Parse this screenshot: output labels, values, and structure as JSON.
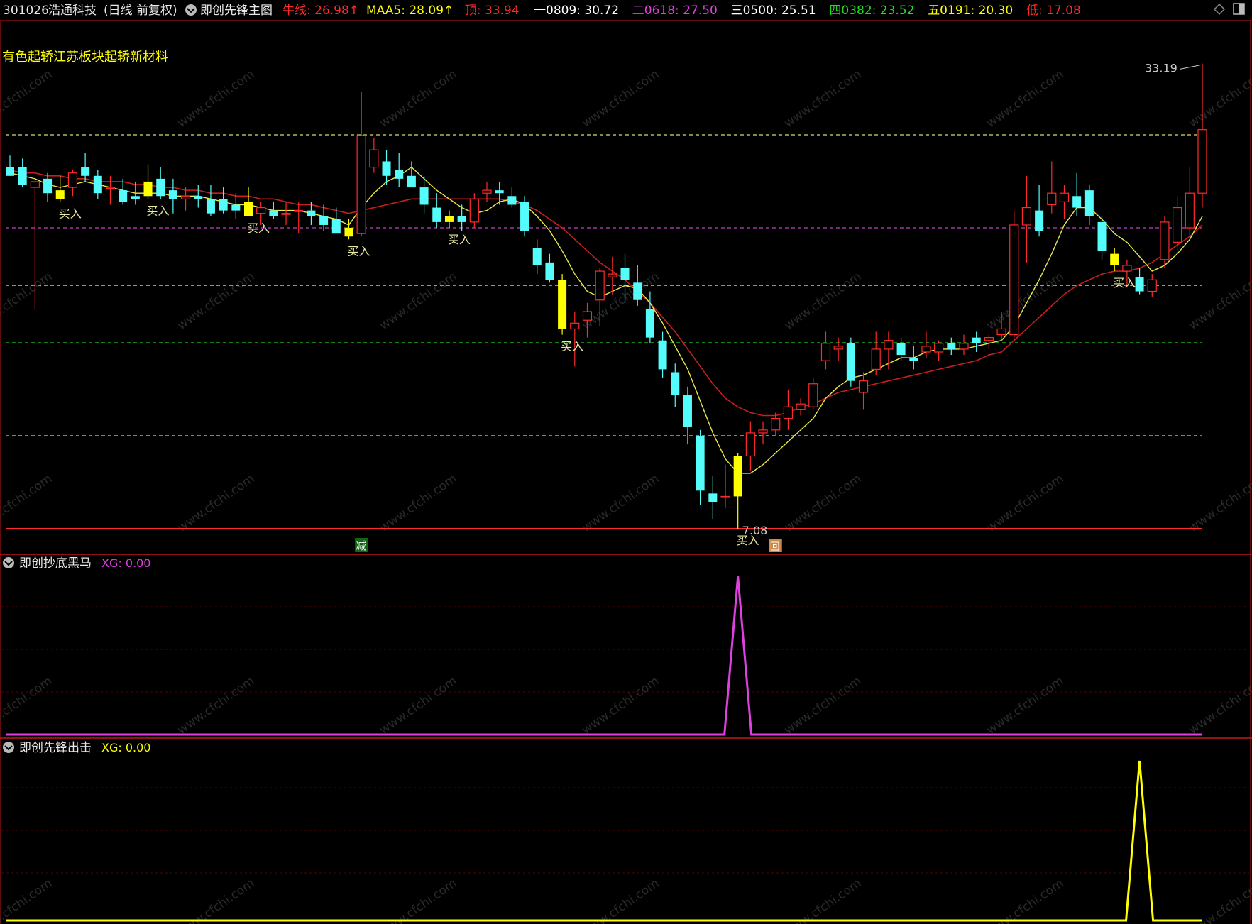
{
  "colors": {
    "red": "#ff2a2a",
    "darkred": "#c01818",
    "cyan": "#54fcfc",
    "yellow": "#ffff00",
    "ma_yellow": "#e8e84a",
    "ma_red": "#c81e1e",
    "magenta": "#e040e0",
    "green": "#22dd22",
    "white": "#e8e8e8",
    "grid": "#5a0000"
  },
  "header": {
    "code": "301026",
    "name": "浩通科技",
    "period": "(日线 前复权)",
    "indicator": "即创先锋主图",
    "items": [
      {
        "label": "牛线:",
        "value": "26.98",
        "arrow": "↑",
        "color": "#ff2a2a"
      },
      {
        "label": "MAA5:",
        "value": "28.09",
        "arrow": "↑",
        "color": "#ffff00"
      },
      {
        "label": "顶:",
        "value": "33.94",
        "arrow": "",
        "color": "#ff2a2a"
      },
      {
        "label": "一0809:",
        "value": "30.72",
        "arrow": "",
        "color": "#ffffff"
      },
      {
        "label": "二0618:",
        "value": "27.50",
        "arrow": "",
        "color": "#e040e0"
      },
      {
        "label": "三0500:",
        "value": "25.51",
        "arrow": "",
        "color": "#ffffff"
      },
      {
        "label": "四0382:",
        "value": "23.52",
        "arrow": "",
        "color": "#22dd22"
      },
      {
        "label": "五0191:",
        "value": "20.30",
        "arrow": "",
        "color": "#ffff00"
      },
      {
        "label": "低:",
        "value": "17.08",
        "arrow": "",
        "color": "#ff2a2a"
      }
    ]
  },
  "sector_text": "有色起轿江苏板块起轿新材料",
  "annotations": {
    "high_label": "33.19",
    "low_label": "7.08",
    "buy_label": "买入",
    "reduce_label": "减",
    "hui_label": "回"
  },
  "panels": [
    {
      "title": "即创抄底黑马",
      "xg_label": "XG: 0.00",
      "xg_color": "#e040e0"
    },
    {
      "title": "即创先锋出击",
      "xg_label": "XG: 0.00",
      "xg_color": "#ffff00"
    }
  ],
  "watermark": "www.cfchi.com",
  "icons": [
    "dropdown-circle-icon",
    "diamond-icon",
    "window-toggle-icon"
  ],
  "chart_data": [
    {
      "type": "candlestick",
      "title": "即创先锋主图",
      "price_levels": [
        {
          "name": "顶",
          "value": 33.94
        },
        {
          "name": "一0809",
          "value": 30.72
        },
        {
          "name": "二0618",
          "value": 27.5
        },
        {
          "name": "三0500",
          "value": 25.51
        },
        {
          "name": "四0382",
          "value": 23.52
        },
        {
          "name": "五0191",
          "value": 20.3
        },
        {
          "name": "低",
          "value": 17.08
        }
      ],
      "candles": [
        {
          "o": 29.6,
          "h": 30.0,
          "l": 29.3,
          "c": 29.3
        },
        {
          "o": 29.6,
          "h": 29.9,
          "l": 28.9,
          "c": 29.0
        },
        {
          "o": 28.9,
          "h": 29.1,
          "l": 24.7,
          "c": 29.1
        },
        {
          "o": 29.2,
          "h": 29.4,
          "l": 28.4,
          "c": 28.7
        },
        {
          "o": 28.8,
          "h": 29.3,
          "l": 28.4,
          "c": 28.5
        },
        {
          "o": 28.9,
          "h": 29.5,
          "l": 28.6,
          "c": 29.4
        },
        {
          "o": 29.6,
          "h": 30.1,
          "l": 29.1,
          "c": 29.3
        },
        {
          "o": 29.3,
          "h": 29.5,
          "l": 28.5,
          "c": 28.7
        },
        {
          "o": 28.9,
          "h": 29.3,
          "l": 28.3,
          "c": 28.9
        },
        {
          "o": 28.8,
          "h": 29.2,
          "l": 28.3,
          "c": 28.4
        },
        {
          "o": 28.6,
          "h": 29.1,
          "l": 28.3,
          "c": 28.5
        },
        {
          "o": 29.1,
          "h": 29.7,
          "l": 28.5,
          "c": 28.6
        },
        {
          "o": 29.2,
          "h": 29.6,
          "l": 28.5,
          "c": 28.6
        },
        {
          "o": 28.8,
          "h": 29.2,
          "l": 28.0,
          "c": 28.5
        },
        {
          "o": 28.5,
          "h": 28.9,
          "l": 28.1,
          "c": 28.6
        },
        {
          "o": 28.6,
          "h": 29.0,
          "l": 28.2,
          "c": 28.5
        },
        {
          "o": 28.5,
          "h": 29.0,
          "l": 27.9,
          "c": 28.0
        },
        {
          "o": 28.5,
          "h": 28.9,
          "l": 28.0,
          "c": 28.1
        },
        {
          "o": 28.3,
          "h": 28.7,
          "l": 27.8,
          "c": 28.1
        },
        {
          "o": 28.4,
          "h": 28.9,
          "l": 27.9,
          "c": 27.9
        },
        {
          "o": 28.0,
          "h": 28.4,
          "l": 27.6,
          "c": 28.2
        },
        {
          "o": 28.1,
          "h": 28.4,
          "l": 27.8,
          "c": 27.9
        },
        {
          "o": 28.0,
          "h": 28.4,
          "l": 27.6,
          "c": 28.0
        },
        {
          "o": 28.1,
          "h": 28.4,
          "l": 27.3,
          "c": 28.1
        },
        {
          "o": 28.1,
          "h": 28.4,
          "l": 27.6,
          "c": 27.9
        },
        {
          "o": 27.9,
          "h": 28.3,
          "l": 27.4,
          "c": 27.6
        },
        {
          "o": 27.8,
          "h": 28.2,
          "l": 27.3,
          "c": 27.3
        },
        {
          "o": 27.5,
          "h": 27.8,
          "l": 27.1,
          "c": 27.2
        },
        {
          "o": 27.3,
          "h": 32.2,
          "l": 27.2,
          "c": 30.7
        },
        {
          "o": 29.6,
          "h": 30.6,
          "l": 29.4,
          "c": 30.2
        },
        {
          "o": 29.8,
          "h": 30.2,
          "l": 29.0,
          "c": 29.3
        },
        {
          "o": 29.5,
          "h": 30.1,
          "l": 28.9,
          "c": 29.2
        },
        {
          "o": 29.3,
          "h": 29.8,
          "l": 28.9,
          "c": 28.9
        },
        {
          "o": 28.9,
          "h": 29.3,
          "l": 28.0,
          "c": 28.3
        },
        {
          "o": 28.2,
          "h": 28.7,
          "l": 27.5,
          "c": 27.7
        },
        {
          "o": 27.7,
          "h": 28.1,
          "l": 27.5,
          "c": 27.9
        },
        {
          "o": 27.9,
          "h": 28.3,
          "l": 27.4,
          "c": 27.7
        },
        {
          "o": 27.7,
          "h": 28.7,
          "l": 27.5,
          "c": 28.5
        },
        {
          "o": 28.7,
          "h": 29.1,
          "l": 28.4,
          "c": 28.8
        },
        {
          "o": 28.8,
          "h": 29.1,
          "l": 28.3,
          "c": 28.7
        },
        {
          "o": 28.6,
          "h": 28.9,
          "l": 28.2,
          "c": 28.3
        },
        {
          "o": 28.4,
          "h": 28.6,
          "l": 27.2,
          "c": 27.4
        },
        {
          "o": 26.8,
          "h": 27.1,
          "l": 25.9,
          "c": 26.2
        },
        {
          "o": 26.3,
          "h": 26.6,
          "l": 25.6,
          "c": 25.7
        },
        {
          "o": 25.7,
          "h": 25.9,
          "l": 23.8,
          "c": 24.0
        },
        {
          "o": 24.0,
          "h": 24.6,
          "l": 22.7,
          "c": 24.2
        },
        {
          "o": 24.3,
          "h": 24.9,
          "l": 23.7,
          "c": 24.6
        },
        {
          "o": 25.0,
          "h": 26.1,
          "l": 24.1,
          "c": 26.0
        },
        {
          "o": 25.8,
          "h": 26.5,
          "l": 25.2,
          "c": 25.9
        },
        {
          "o": 26.1,
          "h": 26.6,
          "l": 24.9,
          "c": 25.7
        },
        {
          "o": 25.6,
          "h": 26.2,
          "l": 24.8,
          "c": 25.0
        },
        {
          "o": 24.7,
          "h": 25.3,
          "l": 23.5,
          "c": 23.7
        },
        {
          "o": 23.6,
          "h": 23.9,
          "l": 22.3,
          "c": 22.6
        },
        {
          "o": 22.5,
          "h": 22.8,
          "l": 21.3,
          "c": 21.7
        },
        {
          "o": 21.7,
          "h": 22.0,
          "l": 20.0,
          "c": 20.6
        },
        {
          "o": 20.3,
          "h": 20.5,
          "l": 17.9,
          "c": 18.4
        },
        {
          "o": 18.3,
          "h": 18.9,
          "l": 17.4,
          "c": 18.0
        },
        {
          "o": 18.2,
          "h": 19.3,
          "l": 17.8,
          "c": 18.2
        },
        {
          "o": 18.2,
          "h": 19.7,
          "l": 17.08,
          "c": 19.6
        },
        {
          "o": 19.6,
          "h": 20.8,
          "l": 19.1,
          "c": 20.4
        },
        {
          "o": 20.4,
          "h": 20.8,
          "l": 20.0,
          "c": 20.5
        },
        {
          "o": 20.5,
          "h": 21.1,
          "l": 20.3,
          "c": 20.9
        },
        {
          "o": 20.9,
          "h": 21.9,
          "l": 20.5,
          "c": 21.3
        },
        {
          "o": 21.2,
          "h": 21.6,
          "l": 21.0,
          "c": 21.4
        },
        {
          "o": 21.3,
          "h": 22.3,
          "l": 21.2,
          "c": 22.1
        },
        {
          "o": 22.9,
          "h": 23.9,
          "l": 22.6,
          "c": 23.5
        },
        {
          "o": 23.3,
          "h": 23.7,
          "l": 22.9,
          "c": 23.4
        },
        {
          "o": 23.5,
          "h": 23.7,
          "l": 22.0,
          "c": 22.2
        },
        {
          "o": 21.8,
          "h": 22.5,
          "l": 21.2,
          "c": 22.2
        },
        {
          "o": 22.6,
          "h": 23.9,
          "l": 22.4,
          "c": 23.3
        },
        {
          "o": 23.3,
          "h": 23.9,
          "l": 22.6,
          "c": 23.6
        },
        {
          "o": 23.5,
          "h": 23.7,
          "l": 22.9,
          "c": 23.1
        },
        {
          "o": 23.0,
          "h": 23.4,
          "l": 22.6,
          "c": 22.9
        },
        {
          "o": 23.2,
          "h": 23.9,
          "l": 23.0,
          "c": 23.4
        },
        {
          "o": 23.2,
          "h": 23.6,
          "l": 22.9,
          "c": 23.5
        },
        {
          "o": 23.5,
          "h": 23.7,
          "l": 23.1,
          "c": 23.3
        },
        {
          "o": 23.3,
          "h": 23.8,
          "l": 23.1,
          "c": 23.5
        },
        {
          "o": 23.7,
          "h": 23.9,
          "l": 23.2,
          "c": 23.5
        },
        {
          "o": 23.6,
          "h": 23.8,
          "l": 23.3,
          "c": 23.7
        },
        {
          "o": 23.8,
          "h": 24.6,
          "l": 23.6,
          "c": 24.0
        },
        {
          "o": 23.8,
          "h": 28.1,
          "l": 23.6,
          "c": 27.6
        },
        {
          "o": 27.6,
          "h": 29.3,
          "l": 26.3,
          "c": 28.2
        },
        {
          "o": 28.1,
          "h": 29.0,
          "l": 27.2,
          "c": 27.4
        },
        {
          "o": 28.3,
          "h": 29.8,
          "l": 28.0,
          "c": 28.7
        },
        {
          "o": 28.4,
          "h": 29.0,
          "l": 27.8,
          "c": 28.7
        },
        {
          "o": 28.6,
          "h": 29.4,
          "l": 27.9,
          "c": 28.2
        },
        {
          "o": 28.8,
          "h": 29.0,
          "l": 27.6,
          "c": 27.9
        },
        {
          "o": 27.7,
          "h": 27.9,
          "l": 26.4,
          "c": 26.7
        },
        {
          "o": 26.6,
          "h": 26.8,
          "l": 26.0,
          "c": 26.2
        },
        {
          "o": 26.0,
          "h": 26.4,
          "l": 25.5,
          "c": 26.2
        },
        {
          "o": 25.8,
          "h": 26.1,
          "l": 25.2,
          "c": 25.3
        },
        {
          "o": 25.3,
          "h": 25.9,
          "l": 25.1,
          "c": 25.7
        },
        {
          "o": 26.4,
          "h": 27.9,
          "l": 26.1,
          "c": 27.7
        },
        {
          "o": 27.0,
          "h": 28.6,
          "l": 26.7,
          "c": 28.2
        },
        {
          "o": 27.5,
          "h": 29.6,
          "l": 27.2,
          "c": 28.7
        },
        {
          "o": 28.7,
          "h": 33.19,
          "l": 28.2,
          "c": 30.9
        }
      ],
      "ma_fast": [
        29.4,
        29.3,
        29.2,
        29.0,
        28.9,
        29.0,
        29.1,
        29.0,
        28.9,
        28.8,
        28.7,
        28.7,
        28.7,
        28.6,
        28.6,
        28.6,
        28.5,
        28.4,
        28.3,
        28.3,
        28.2,
        28.1,
        28.1,
        28.1,
        28.0,
        27.9,
        27.8,
        27.6,
        28.2,
        28.7,
        29.1,
        29.3,
        29.6,
        29.2,
        28.8,
        28.5,
        28.2,
        28.0,
        28.1,
        28.4,
        28.5,
        28.3,
        27.9,
        27.4,
        26.7,
        25.9,
        25.3,
        25.1,
        25.3,
        25.5,
        25.4,
        24.9,
        24.2,
        23.4,
        22.6,
        21.5,
        20.4,
        19.5,
        19.0,
        19.0,
        19.3,
        19.7,
        20.1,
        20.5,
        20.9,
        21.6,
        22.0,
        22.3,
        22.4,
        22.6,
        22.8,
        23.0,
        23.0,
        23.2,
        23.3,
        23.3,
        23.3,
        23.4,
        23.5,
        23.6,
        24.1,
        24.9,
        25.7,
        26.6,
        27.6,
        28.2,
        28.2,
        27.8,
        27.3,
        27.0,
        26.5,
        26.0,
        26.2,
        26.6,
        27.1,
        27.9
      ],
      "ma_slow": [
        29.5,
        29.4,
        29.4,
        29.3,
        29.3,
        29.2,
        29.2,
        29.1,
        29.1,
        29.1,
        29.0,
        29.0,
        28.9,
        28.9,
        28.8,
        28.8,
        28.7,
        28.7,
        28.6,
        28.6,
        28.5,
        28.5,
        28.4,
        28.3,
        28.3,
        28.2,
        28.1,
        28.0,
        28.1,
        28.2,
        28.3,
        28.4,
        28.5,
        28.5,
        28.5,
        28.5,
        28.5,
        28.5,
        28.5,
        28.5,
        28.4,
        28.3,
        28.1,
        27.8,
        27.5,
        27.1,
        26.7,
        26.3,
        26.0,
        25.7,
        25.3,
        24.9,
        24.4,
        23.9,
        23.3,
        22.7,
        22.1,
        21.6,
        21.3,
        21.1,
        21.0,
        21.0,
        21.1,
        21.3,
        21.4,
        21.6,
        21.8,
        21.9,
        22.0,
        22.1,
        22.2,
        22.3,
        22.4,
        22.5,
        22.6,
        22.7,
        22.8,
        22.9,
        23.1,
        23.2,
        23.6,
        24.0,
        24.4,
        24.8,
        25.2,
        25.5,
        25.7,
        25.9,
        26.0,
        26.0,
        26.1,
        26.3,
        26.6,
        26.9,
        27.2,
        27.6
      ],
      "buy_signals": [
        4,
        11,
        19,
        27,
        35,
        44,
        58,
        88
      ],
      "reduce_signal": 28,
      "hui_signal": 61
    },
    {
      "type": "line",
      "title": "即创抄底黑马",
      "series": [
        {
          "name": "XG",
          "spike_index": 58,
          "spike_value": 1,
          "baseline": 0
        }
      ]
    },
    {
      "type": "line",
      "title": "即创先锋出击",
      "series": [
        {
          "name": "XG",
          "spike_index": 90,
          "spike_value": 1,
          "baseline": 0
        }
      ]
    }
  ]
}
